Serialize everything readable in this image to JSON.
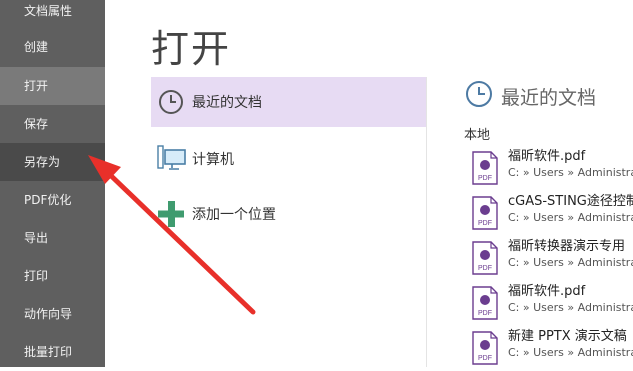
{
  "sidebar": {
    "items": [
      {
        "label": "文档属性"
      },
      {
        "label": "创建"
      },
      {
        "label": "打开"
      },
      {
        "label": "保存"
      },
      {
        "label": "另存为"
      },
      {
        "label": "PDF优化"
      },
      {
        "label": "导出"
      },
      {
        "label": "打印"
      },
      {
        "label": "动作向导"
      },
      {
        "label": "批量打印"
      }
    ]
  },
  "main": {
    "title": "打开",
    "locations": [
      {
        "label": "最近的文档",
        "icon": "clock-icon"
      },
      {
        "label": "计算机",
        "icon": "computer-icon"
      },
      {
        "label": "添加一个位置",
        "icon": "plus-icon"
      }
    ],
    "recent": {
      "title": "最近的文档",
      "section_label": "本地",
      "files": [
        {
          "name": "福昕软件.pdf",
          "path": "C: » Users » Administra"
        },
        {
          "name": "cGAS-STING途径控制",
          "path": "C: » Users » Administra"
        },
        {
          "name": "福昕转换器演示专用",
          "path": "C: » Users » Administra"
        },
        {
          "name": "福昕软件.pdf",
          "path": "C: » Users » Administra"
        },
        {
          "name": "新建 PPTX 演示文稿",
          "path": "C: » Users » Administra"
        }
      ]
    }
  },
  "colors": {
    "sidebar_bg": "#5f5f5f",
    "selected_bg": "#e7dbf3",
    "pdf_icon_purple": "#6b3d8f",
    "plus_green": "#3f9b6f",
    "arrow_red": "#e8302a"
  }
}
